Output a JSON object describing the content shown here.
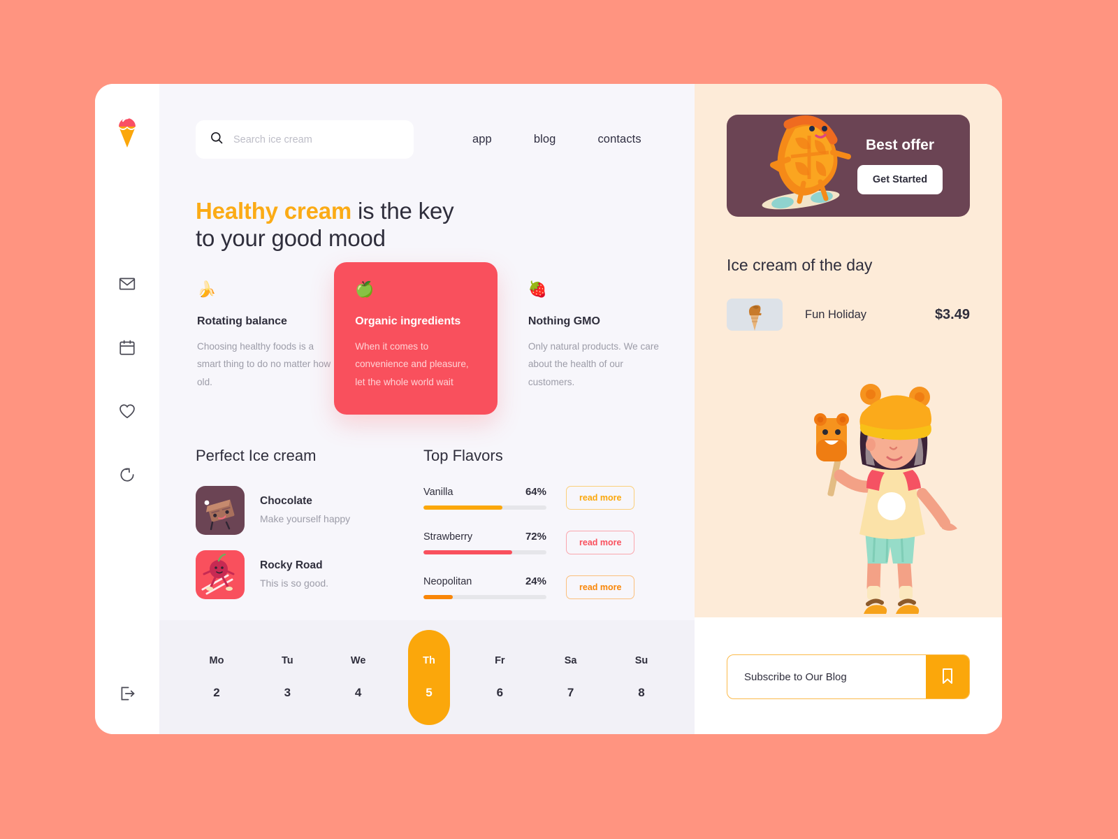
{
  "brand": {
    "logo_icon": "ice-cream-cone-icon"
  },
  "sidebar": {
    "items": [
      {
        "icon": "mail-icon",
        "name": "messages"
      },
      {
        "icon": "calendar-icon",
        "name": "calendar"
      },
      {
        "icon": "heart-icon",
        "name": "favorites"
      },
      {
        "icon": "refresh-icon",
        "name": "history"
      }
    ],
    "bottom": {
      "icon": "logout-icon",
      "name": "logout"
    }
  },
  "search": {
    "placeholder": "Search ice cream",
    "value": "",
    "icon": "search-icon"
  },
  "nav": [
    {
      "label": "app"
    },
    {
      "label": "blog"
    },
    {
      "label": "contacts"
    }
  ],
  "hero": {
    "highlight": "Healthy cream",
    "rest": " is the key",
    "line2": "to your good mood"
  },
  "features": [
    {
      "icon": "banana-icon",
      "glyph": "🍌",
      "title": "Rotating balance",
      "body": "Choosing healthy foods is a smart thing to do no matter how old."
    },
    {
      "icon": "apple-icon",
      "glyph": "🍏",
      "title": "Organic ingredients",
      "body": "When it comes to convenience and pleasure, let the whole world wait"
    },
    {
      "icon": "strawberry-icon",
      "glyph": "🍓",
      "title": "Nothing GMO",
      "body": "Only natural products. We care about the health of our customers."
    }
  ],
  "perfect": {
    "title": "Perfect Ice cream",
    "items": [
      {
        "name": "Chocolate",
        "desc": "Make yourself happy",
        "thumb_color": "#6B4454",
        "thumb_icon": "chocolate-bar-illustration"
      },
      {
        "name": "Rocky Road",
        "desc": "This is so good.",
        "thumb_color": "#F9505D",
        "thumb_icon": "cherry-skier-illustration"
      }
    ]
  },
  "flavors": {
    "title": "Top Flavors",
    "read_more_label": "read more",
    "items": [
      {
        "name": "Vanilla",
        "percent": "64%",
        "value": 64,
        "bar_color": "#FBA70B",
        "button_color": "#FBA70B",
        "button_border": "#FBCF7A"
      },
      {
        "name": "Strawberry",
        "percent": "72%",
        "value": 72,
        "bar_color": "#F9505D",
        "button_color": "#F9505D",
        "button_border": "#FAA6AD"
      },
      {
        "name": "Neopolitan",
        "percent": "24%",
        "value": 24,
        "bar_color": "#F98608",
        "button_color": "#F98608",
        "button_border": "#FBBF7C"
      }
    ]
  },
  "chart_data": {
    "type": "bar",
    "title": "Top Flavors",
    "categories": [
      "Vanilla",
      "Strawberry",
      "Neopolitan"
    ],
    "values": [
      64,
      72,
      24
    ],
    "xlabel": "",
    "ylabel": "",
    "ylim": [
      0,
      100
    ],
    "unit": "%",
    "colors": [
      "#FBA70B",
      "#F9505D",
      "#F98608"
    ],
    "grid": false,
    "legend": "none"
  },
  "calendar": {
    "days": [
      {
        "day": "Mo",
        "date": "2",
        "active": false
      },
      {
        "day": "Tu",
        "date": "3",
        "active": false
      },
      {
        "day": "We",
        "date": "4",
        "active": false
      },
      {
        "day": "Th",
        "date": "5",
        "active": true
      },
      {
        "day": "Fr",
        "date": "6",
        "active": false
      },
      {
        "day": "Sa",
        "date": "7",
        "active": false
      },
      {
        "day": "Su",
        "date": "8",
        "active": false
      }
    ]
  },
  "offer": {
    "title": "Best offer",
    "button_label": "Get Started",
    "illustration": "orange-slice-skateboarder-illustration",
    "card_color": "#6B4454"
  },
  "daily": {
    "title": "Ice cream of the day",
    "item": {
      "name": "Fun Holiday",
      "price": "$3.49",
      "thumb_icon": "ice-cream-cone-photo"
    }
  },
  "hero_illustration": "girl-with-popsicle-illustration",
  "subscribe": {
    "placeholder": "Subscribe to Our Blog",
    "value": "",
    "button_icon": "bookmark-icon",
    "button_color": "#FBA70B"
  },
  "theme": {
    "page_bg": "#FF9480",
    "card_bg": "#FFFFFF",
    "center_bg": "#F7F6FB",
    "calendar_bg": "#F2F1F7",
    "right_bg": "#FDEBD8",
    "accent_orange": "#FBA70B",
    "accent_red": "#F9505D",
    "text_dark": "#2F2E3C",
    "text_muted": "#9C9CA8"
  }
}
